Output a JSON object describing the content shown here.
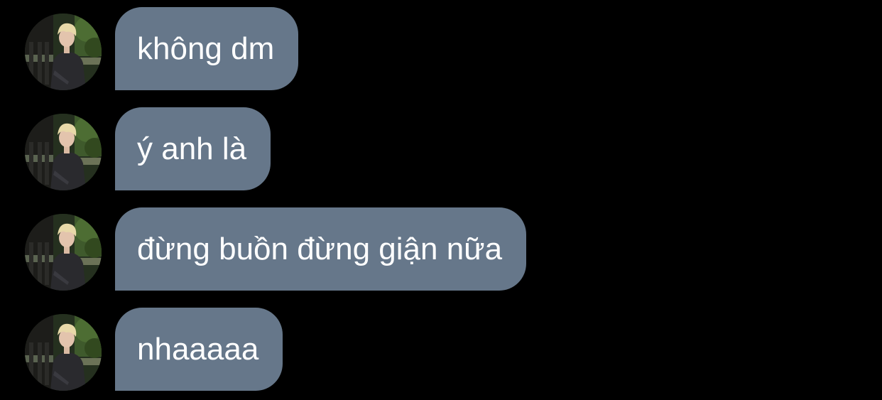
{
  "theme": {
    "background": "#000000",
    "bubble_color": "#66778a",
    "text_color": "#ffffff"
  },
  "messages": [
    {
      "text": "không dm",
      "avatar_icon": "user-avatar-icon"
    },
    {
      "text": "ý anh là",
      "avatar_icon": "user-avatar-icon"
    },
    {
      "text": "đừng buồn đừng giận nữa",
      "avatar_icon": "user-avatar-icon"
    },
    {
      "text": "nhaaaaa",
      "avatar_icon": "user-avatar-icon"
    }
  ]
}
